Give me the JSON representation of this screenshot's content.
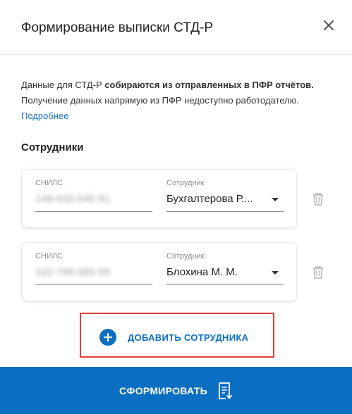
{
  "dialog": {
    "title": "Формирование выписки СТД-Р",
    "close_icon": "close-icon"
  },
  "info": {
    "line1_prefix": "Данные для СТД-Р ",
    "line1_bold": "собираются из отправленных в ПФР отчётов.",
    "line2": "Получение данных напрямую из ПФР недоступно работодателю.",
    "link": "Подробнее"
  },
  "employees_section": {
    "title": "Сотрудники",
    "rows": [
      {
        "snils_label": "СНИЛС",
        "snils_value": "149-632-045 91",
        "employee_label": "Сотрудник",
        "employee_value": "Бухгалтерова Р...."
      },
      {
        "snils_label": "СНИЛС",
        "snils_value": "122-796-084 69",
        "employee_label": "Сотрудник",
        "employee_value": "Блохина М. М."
      }
    ]
  },
  "add_button": {
    "label": "ДОБАВИТЬ СОТРУДНИКА",
    "icon": "plus-circle-icon"
  },
  "submit_button": {
    "label": "СФОРМИРОВАТЬ",
    "icon": "document-download-icon"
  },
  "colors": {
    "accent": "#0a6fc2",
    "highlight": "#e0403a",
    "link": "#1a73c8"
  }
}
